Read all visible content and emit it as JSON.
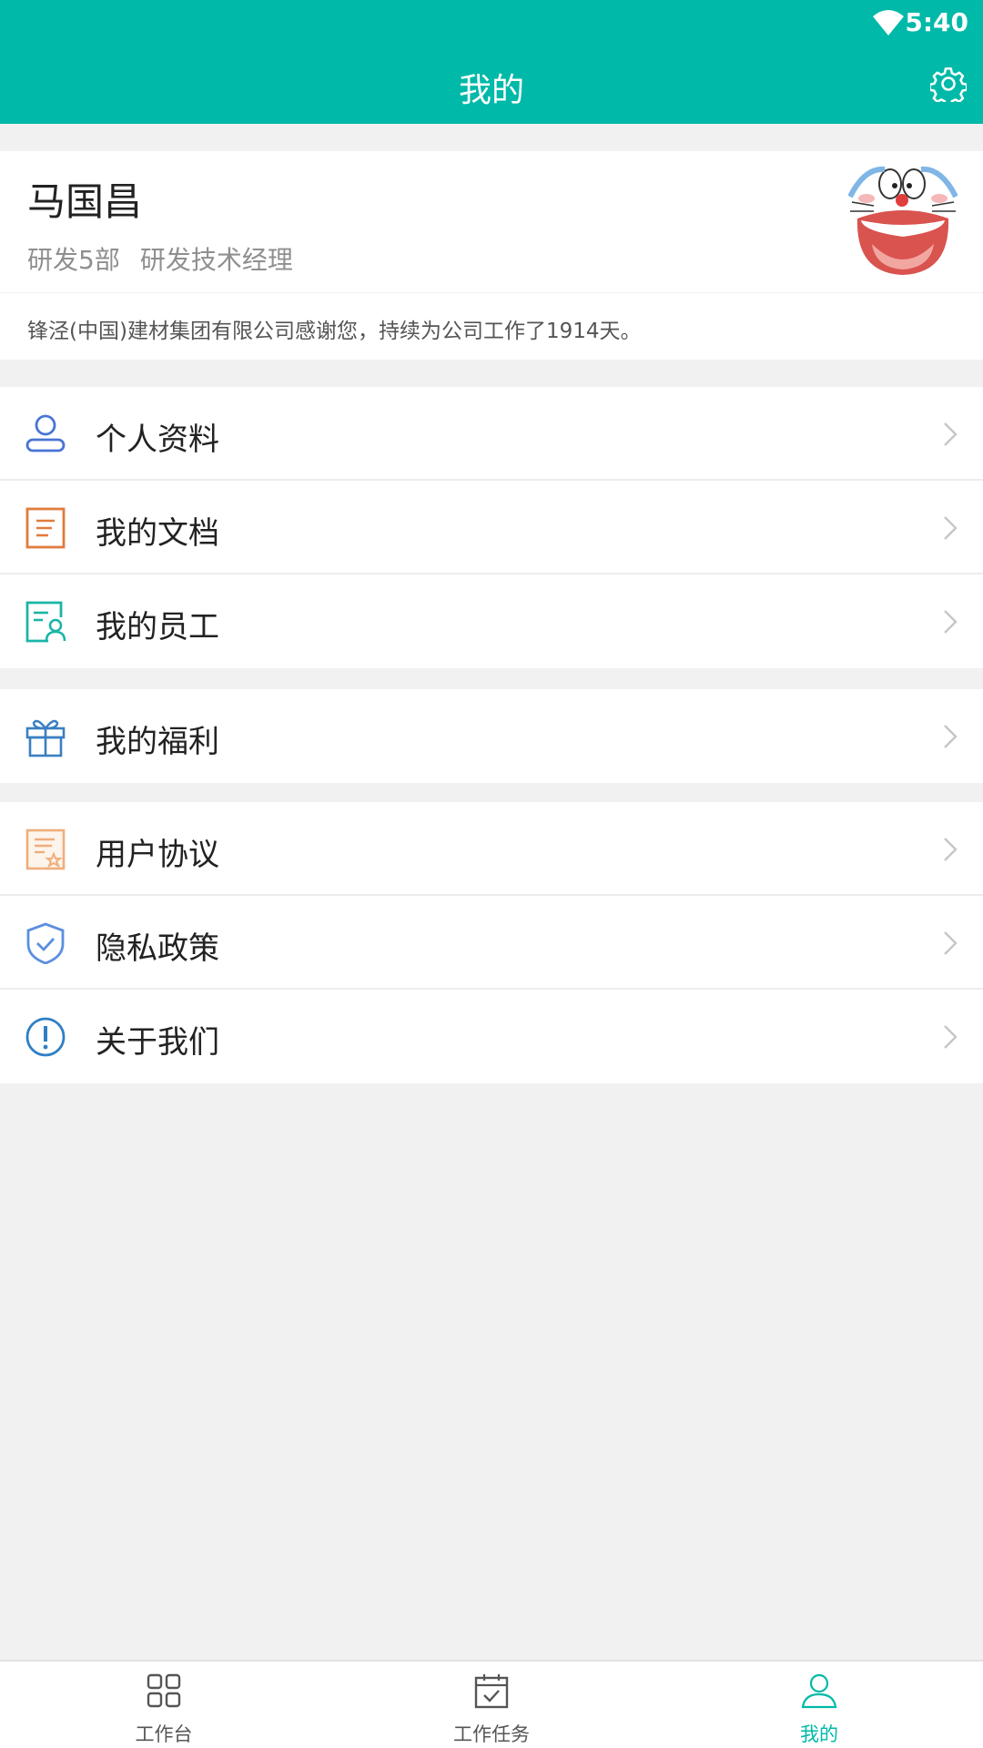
{
  "status_bar": {
    "time": "5:40"
  },
  "header": {
    "title": "我的",
    "settings_icon": "gear-icon"
  },
  "profile": {
    "name": "马国昌",
    "department": "研发5部",
    "position": "研发技术经理",
    "thanks_message": "锋泾(中国)建材集团有限公司感谢您，持续为公司工作了1914天。"
  },
  "menu_groups": [
    [
      {
        "label": "个人资料",
        "icon": "person-icon"
      },
      {
        "label": "我的文档",
        "icon": "document-icon"
      },
      {
        "label": "我的员工",
        "icon": "employee-icon"
      }
    ],
    [
      {
        "label": "我的福利",
        "icon": "gift-icon"
      }
    ],
    [
      {
        "label": "用户协议",
        "icon": "agreement-icon"
      },
      {
        "label": "隐私政策",
        "icon": "shield-icon"
      },
      {
        "label": "关于我们",
        "icon": "info-icon"
      }
    ]
  ],
  "tabs": [
    {
      "label": "工作台",
      "icon": "grid-icon",
      "active": false
    },
    {
      "label": "工作任务",
      "icon": "calendar-check-icon",
      "active": false
    },
    {
      "label": "我的",
      "icon": "person-icon",
      "active": true
    }
  ],
  "colors": {
    "accent": "#00b9a8",
    "person_icon": "#4a74d4",
    "document_icon": "#e07c3c",
    "employee_icon": "#1bb5a6",
    "gift_icon": "#3a7fc1",
    "agreement_icon": "#efae7c",
    "shield_icon": "#5b8fe0",
    "info_icon": "#2f7fc5"
  }
}
